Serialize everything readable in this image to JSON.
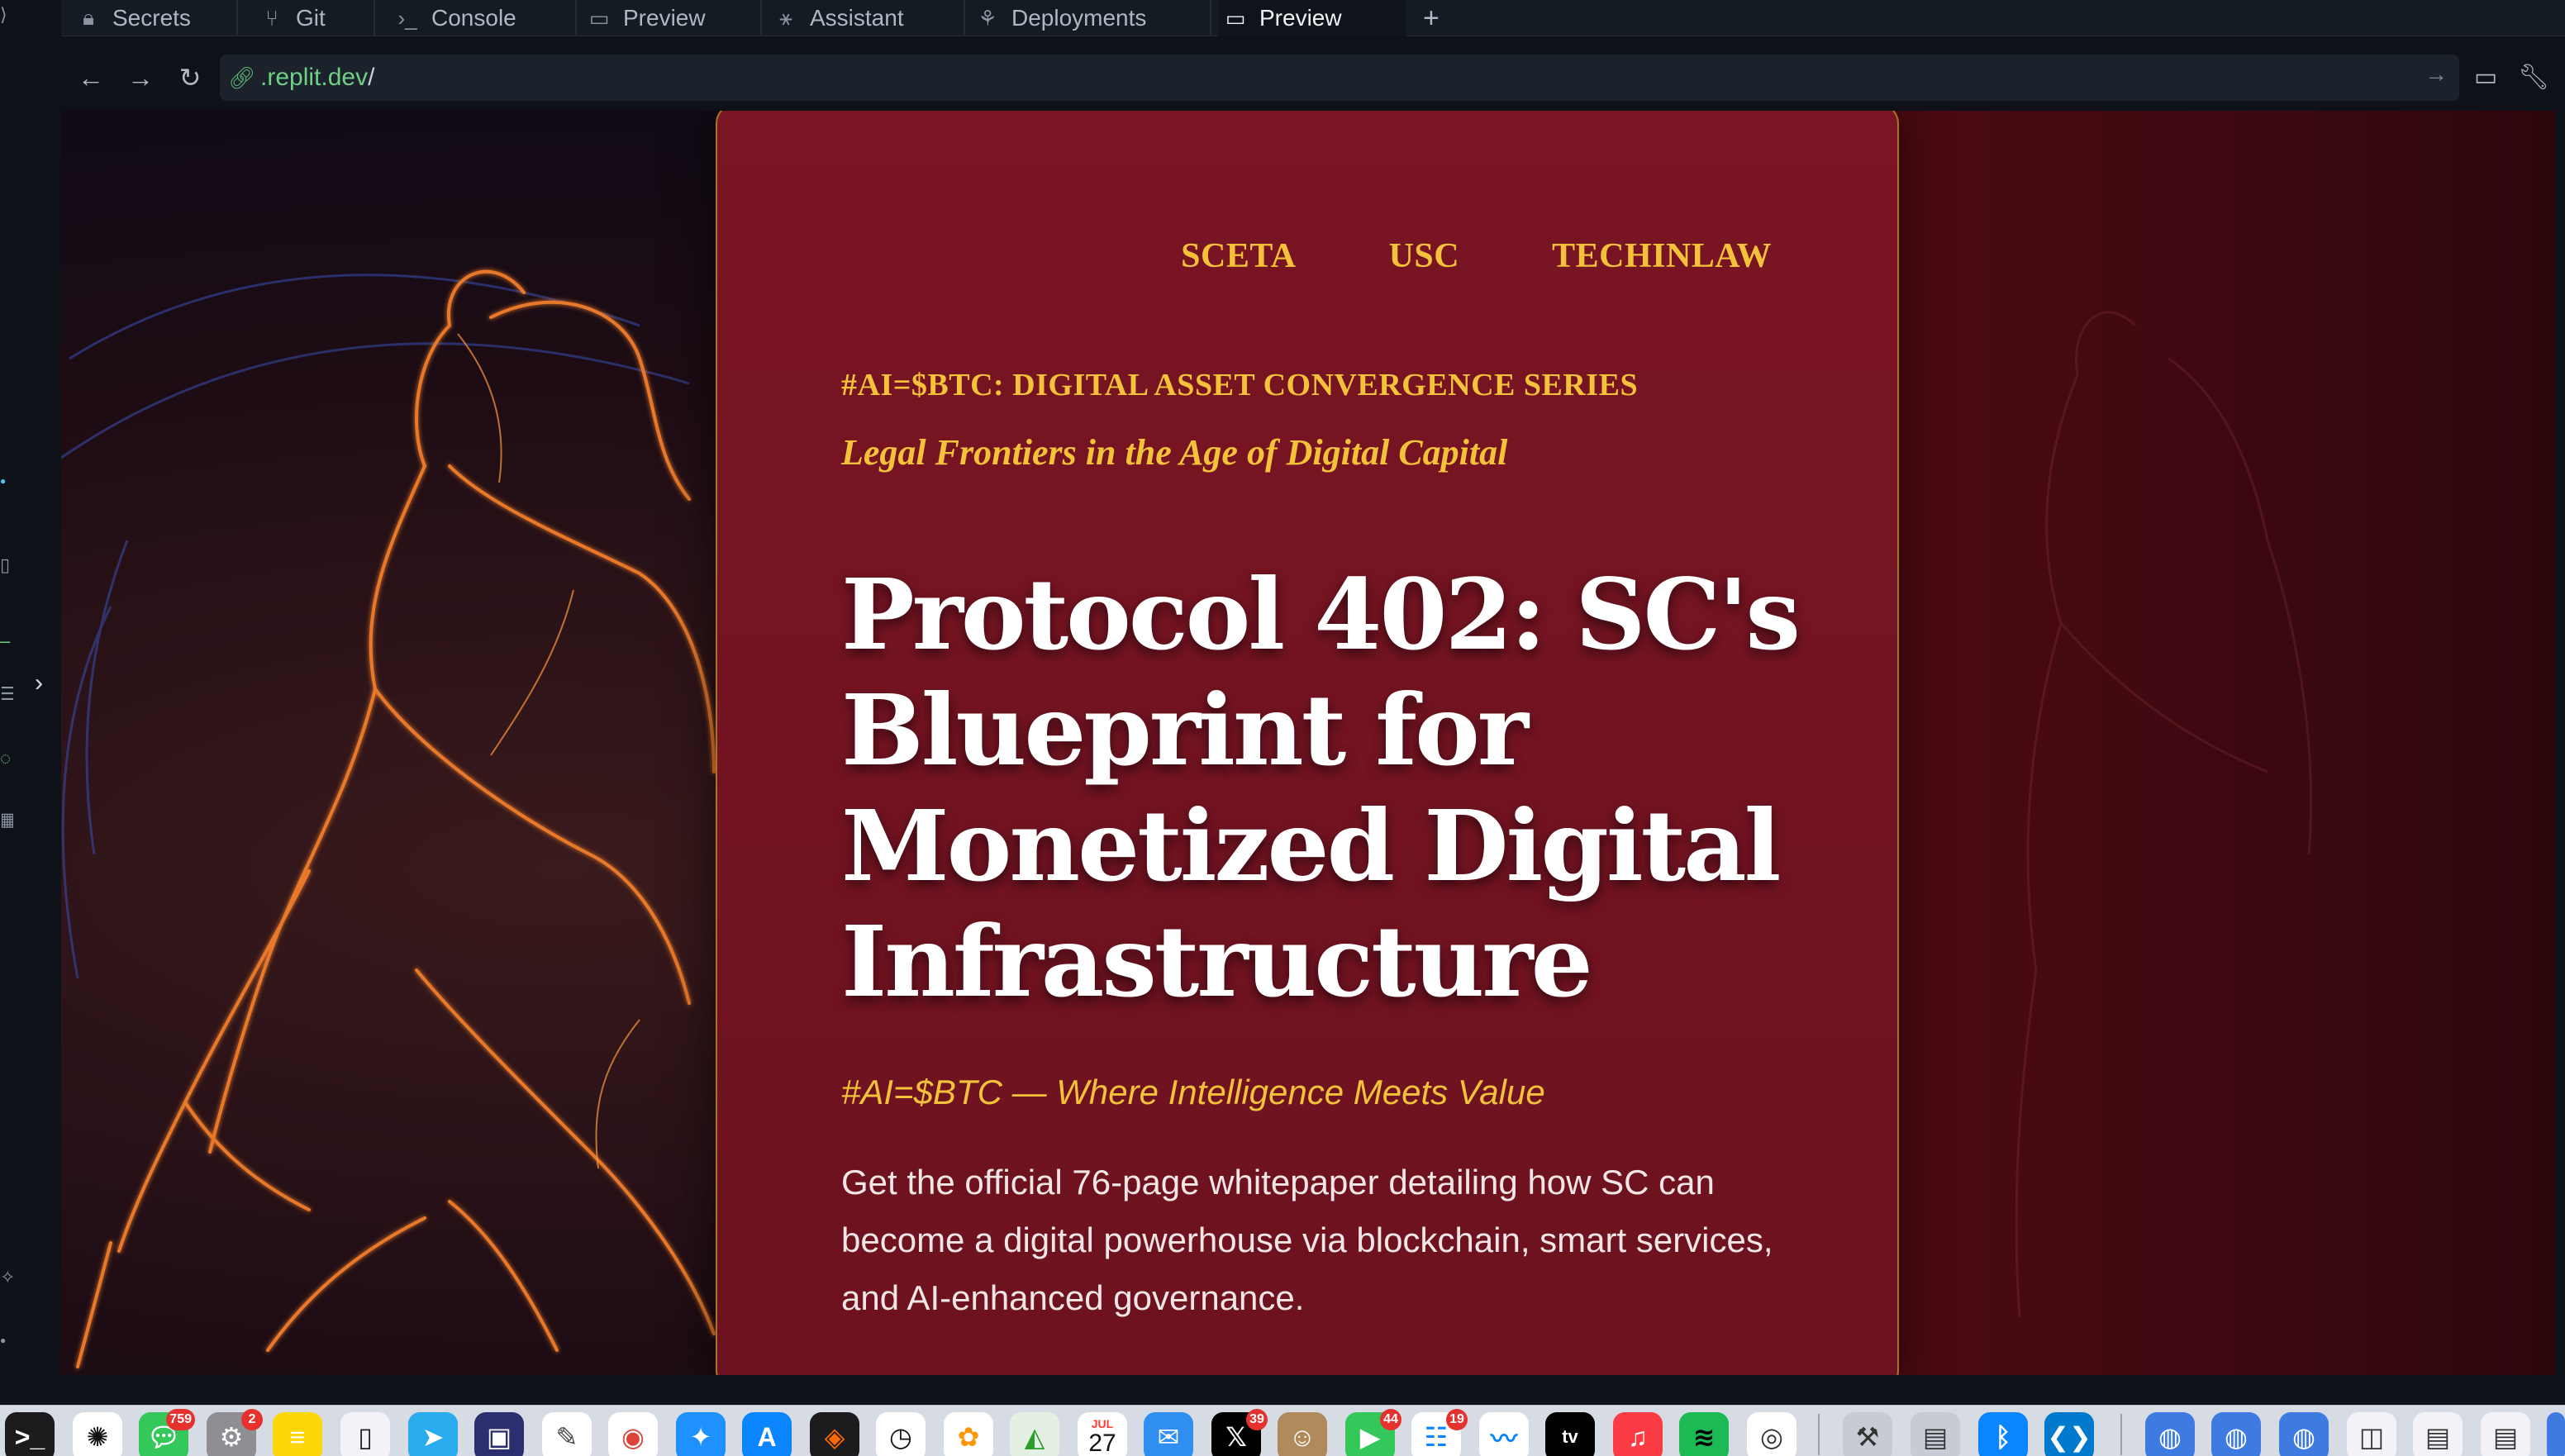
{
  "tabs": [
    {
      "label": "Secrets",
      "icon": "lock-icon"
    },
    {
      "label": "Git",
      "icon": "git-icon"
    },
    {
      "label": "Console",
      "icon": "terminal-icon"
    },
    {
      "label": "Preview",
      "icon": "monitor-icon"
    },
    {
      "label": "Assistant",
      "icon": "assistant-icon"
    },
    {
      "label": "Deployments",
      "icon": "deployments-icon"
    },
    {
      "label": "Preview",
      "icon": "monitor-icon",
      "active": true
    }
  ],
  "address_bar": {
    "host": ".replit.dev",
    "path": "/"
  },
  "page": {
    "nav": [
      "SCETA",
      "USC",
      "TECHINLAW"
    ],
    "series": "#AI=$BTC: DIGITAL ASSET CONVERGENCE SERIES",
    "tagline": "Legal Frontiers in the Age of Digital Capital",
    "headline_lines": [
      "Protocol 402: SC's",
      "Blueprint for",
      "Monetized Digital",
      "Infrastructure"
    ],
    "sub_tag": "#AI=$BTC — Where Intelligence Meets Value",
    "body": "Get the official 76-page whitepaper detailing how SC can become a digital powerhouse via blockchain, smart services, and AI-enhanced governance."
  },
  "dock": {
    "badges": {
      "messages": "759",
      "system_settings": "2",
      "x": "39",
      "facetime": "44",
      "reminders": "19"
    },
    "calendar": {
      "month": "JUL",
      "day": "27"
    }
  },
  "colors": {
    "accent_gold": "#f3c13a",
    "card_red": "#7a1523",
    "dark_bg": "#0e1218"
  }
}
